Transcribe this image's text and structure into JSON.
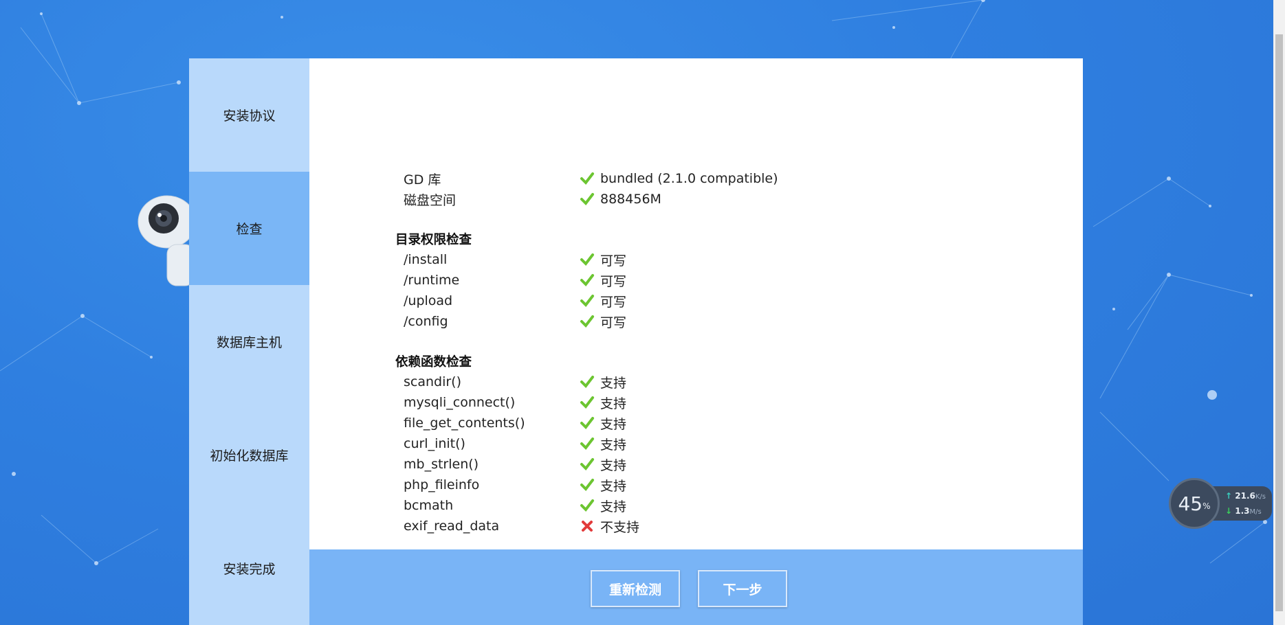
{
  "sidebar": {
    "items": [
      {
        "label": "安装协议",
        "active": false
      },
      {
        "label": "检查",
        "active": true
      },
      {
        "label": "数据库主机",
        "active": false
      },
      {
        "label": "初始化数据库",
        "active": false
      },
      {
        "label": "安装完成",
        "active": false
      }
    ]
  },
  "env_rows": [
    {
      "name": "GD 库",
      "value": "bundled (2.1.0 compatible)",
      "status": "ok"
    },
    {
      "name": "磁盘空间",
      "value": "888456M",
      "status": "ok"
    }
  ],
  "dir_section": {
    "title": "目录权限检查",
    "rows": [
      {
        "name": "/install",
        "value": "可写",
        "status": "ok"
      },
      {
        "name": "/runtime",
        "value": "可写",
        "status": "ok"
      },
      {
        "name": "/upload",
        "value": "可写",
        "status": "ok"
      },
      {
        "name": "/config",
        "value": "可写",
        "status": "ok"
      }
    ]
  },
  "func_section": {
    "title": "依赖函数检查",
    "rows": [
      {
        "name": "scandir()",
        "value": "支持",
        "status": "ok"
      },
      {
        "name": "mysqli_connect()",
        "value": "支持",
        "status": "ok"
      },
      {
        "name": "file_get_contents()",
        "value": "支持",
        "status": "ok"
      },
      {
        "name": "curl_init()",
        "value": "支持",
        "status": "ok"
      },
      {
        "name": "mb_strlen()",
        "value": "支持",
        "status": "ok"
      },
      {
        "name": "php_fileinfo",
        "value": "支持",
        "status": "ok"
      },
      {
        "name": "bcmath",
        "value": "支持",
        "status": "ok"
      },
      {
        "name": "exif_read_data",
        "value": "不支持",
        "status": "fail"
      }
    ]
  },
  "buttons": {
    "recheck": "重新检测",
    "next": "下一步"
  },
  "speed_widget": {
    "percent": "45",
    "percent_unit": "%",
    "upload": "21.6",
    "upload_unit": "K/s",
    "download": "1.3",
    "download_unit": "M/s"
  },
  "colors": {
    "ok": "#6cc531",
    "fail": "#e23b3b",
    "sidebar_active": "#7ab6f6",
    "sidebar": "#b9d9fb",
    "footer": "#79b4f6"
  }
}
